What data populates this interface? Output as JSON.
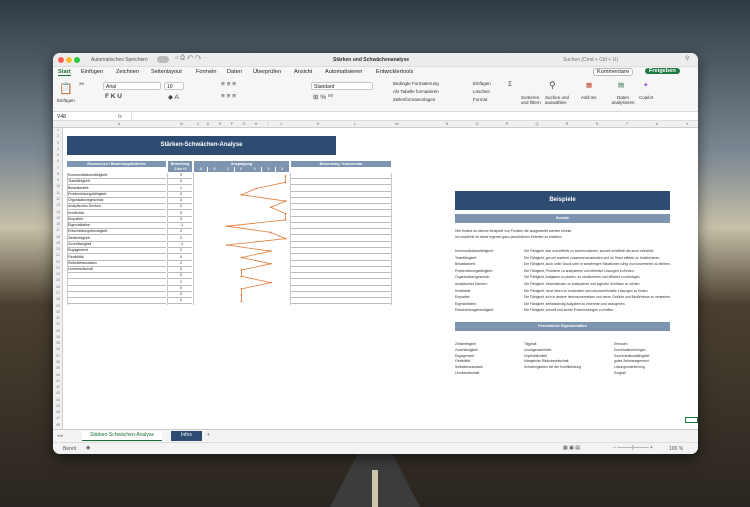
{
  "window": {
    "autosave": "Automatisches Speichern",
    "title": "Stärken und Schwächenanalyse",
    "search": "Suchen (Cmd + Ctrl + U)",
    "comments": "Kommentare",
    "share": "Freigeben"
  },
  "tabs": [
    "Start",
    "Einfügen",
    "Zeichnen",
    "Seitenlayout",
    "Formeln",
    "Daten",
    "Überprüfen",
    "Ansicht",
    "Automatisieren",
    "Entwicklertools"
  ],
  "ribbon": {
    "paste": "Einfügen",
    "font": "Arial",
    "size": "10",
    "format": "Standard",
    "cond": "Bedingte Formatierung",
    "astable": "Als Tabelle formatieren",
    "cellstyles": "Zellenformatvorlagen",
    "insert": "Einfügen",
    "delete": "Löschen",
    "formatcells": "Format",
    "sort": "Sortieren und filtern",
    "find": "Suchen und auswählen",
    "addins": "Add-Ins",
    "analyze": "Daten analysieren",
    "copilot": "Copilot"
  },
  "formula": {
    "cellref": "V48",
    "fx": "fx"
  },
  "columns": [
    "A",
    "B",
    "C",
    "D",
    "E",
    "F",
    "G",
    "H",
    "I",
    "J",
    "K",
    "L",
    "M",
    "N",
    "O",
    "P",
    "Q",
    "R",
    "S",
    "T",
    "U",
    "V"
  ],
  "rows": [
    "1",
    "2",
    "3",
    "4",
    "5",
    "6",
    "7",
    "8",
    "9",
    "10",
    "11",
    "12",
    "13",
    "14",
    "15",
    "16",
    "17",
    "18",
    "19",
    "20",
    "21",
    "22",
    "23",
    "24",
    "25",
    "26",
    "27",
    "28",
    "29",
    "30",
    "31",
    "32",
    "33",
    "34",
    "35",
    "36",
    "37",
    "38",
    "39",
    "40",
    "41",
    "42",
    "43",
    "44",
    "45",
    "46",
    "47",
    "48"
  ],
  "left": {
    "title": "Stärken-Schwächen-Analyse",
    "h_res": "Ressourcen / Bewertungskriterien",
    "h_bew": "Bewertung",
    "h_range": "-3 bis +3",
    "h_aus": "Ausprägung",
    "h_kom": "Bemerkung / Kommentar",
    "scale": [
      "-3",
      "-2",
      "-1",
      "0",
      "1",
      "2",
      "3"
    ],
    "items": [
      {
        "name": "Kommunikationsfähigkeit:",
        "v": "3"
      },
      {
        "name": "Teamfähigkeit:",
        "v": "3"
      },
      {
        "name": "Belastbarkeit:",
        "v": "1"
      },
      {
        "name": "Problemlösungsfähigkeit:",
        "v": "0"
      },
      {
        "name": "Organisationsgeschick:",
        "v": "3"
      },
      {
        "name": "Analytisches Denken:",
        "v": "2"
      },
      {
        "name": "Kreativität:",
        "v": "3"
      },
      {
        "name": "Empathie:",
        "v": "3"
      },
      {
        "name": "Eigeninitiative:",
        "v": "-1"
      },
      {
        "name": "Entscheidungsfreudigkeit:",
        "v": "2"
      },
      {
        "name": "Zielstrebigkeit",
        "v": "3"
      },
      {
        "name": "Zuverlässigkeit",
        "v": "-1"
      },
      {
        "name": "Engagement",
        "v": "2"
      },
      {
        "name": "Flexibilität",
        "v": "0"
      },
      {
        "name": "Selbstbewusstsein",
        "v": "2"
      },
      {
        "name": "Lernbereitschaft",
        "v": "0"
      },
      {
        "name": "",
        "v": "0"
      },
      {
        "name": "",
        "v": "2"
      },
      {
        "name": "",
        "v": "0"
      },
      {
        "name": "",
        "v": "0"
      },
      {
        "name": "",
        "v": "0"
      }
    ]
  },
  "right": {
    "title": "Beispiele",
    "s1": "Soziale",
    "intro1": "Hier findest du diverse Beispiele von Punkten die ausgewertet werden könnte.",
    "intro2": "Ich empfehle dir deine eigenen ganz persönlichen Kriterien zu erstellen",
    "defs": [
      [
        "Kommunikationsfähigkeit:",
        "Die Fähigkeit, klar und effektiv zu kommunizieren, sowohl schriftlich als auch mündlich."
      ],
      [
        "Teamfähigkeit:",
        "Die Fähigkeit, gut mit anderen zusammenzuarbeiten und im Team effektiv zu funktionieren."
      ],
      [
        "Belastbarkeit:",
        "Die Fähigkeit, auch unter Druck oder in schwierigen Situationen ruhig und konzentriert zu bleiben."
      ],
      [
        "Problemlösungsfähigkeit:",
        "Die Fähigkeit, Probleme zu analysieren und effektive Lösungen zu finden."
      ],
      [
        "Organisationsgeschick:",
        "Die Fähigkeit, Aufgaben zu planen, zu strukturieren und effizient zu erledigen."
      ],
      [
        "Analytisches Denken:",
        "Die Fähigkeit, Informationen zu analysieren und logische Schlüsse zu ziehen."
      ],
      [
        "Kreativität:",
        "Die Fähigkeit, neue Ideen zu entwickeln und unkonventionelle Lösungen zu finden."
      ],
      [
        "Empathie:",
        "Die Fähigkeit, sich in andere hineinzuversetzen und deren Gefühle und Bedürfnisse zu verstehen."
      ],
      [
        "Eigeninitiative:",
        "Die Fähigkeit, selbstständig Aufgaben zu erkennen und anzugehen."
      ],
      [
        "Entscheidungsfreudigkeit:",
        "Die Fähigkeit, schnell und sicher Entscheidungen zu treffen."
      ]
    ],
    "s2": "Persönliche Eigenschaften",
    "traits": [
      [
        "Zielstrebigkeit",
        "Tilgyhalt",
        "Ehrsucht"
      ],
      [
        "Zuverlässigkeit",
        "Unzulgenarbeiheit",
        "Durchhaltevermögen"
      ],
      [
        "Engagement",
        "Unpünktlichkeit",
        "Konzentrationsfähigkeit"
      ],
      [
        "Flexibilität",
        "Mangelnde Risikobereitschaft",
        "gutes Zeitmanagement"
      ],
      [
        "Selbstbewusstsein",
        "Schwierigkeiten bei der Konfliktlösung",
        "Lösungsorientierung"
      ],
      [
        "Lernbereitschaft",
        "",
        "Sorgfalt"
      ]
    ]
  },
  "sheets": {
    "active": "Stärken-Schwächen-Analyse",
    "other": "Infos",
    "add": "+"
  },
  "status": {
    "ready": "Bereit",
    "zoom": "100 %"
  },
  "chart_data": {
    "type": "line",
    "x": [
      "Kommunikationsfähigkeit:",
      "Teamfähigkeit:",
      "Belastbarkeit:",
      "Problemlösungsfähigkeit:",
      "Organisationsgeschick:",
      "Analytisches Denken:",
      "Kreativität:",
      "Empathie:",
      "Eigeninitiative:",
      "Entscheidungsfreudigkeit:",
      "Zielstrebigkeit",
      "Zuverlässigkeit",
      "Engagement",
      "Flexibilität",
      "Selbstbewusstsein",
      "Lernbereitschaft",
      "",
      "",
      "",
      "",
      ""
    ],
    "values": [
      3,
      3,
      1,
      0,
      3,
      2,
      3,
      3,
      -1,
      2,
      3,
      -1,
      2,
      0,
      2,
      0,
      0,
      2,
      0,
      0,
      0
    ],
    "xlim": [
      -3,
      3
    ],
    "color": "#e07b39"
  }
}
